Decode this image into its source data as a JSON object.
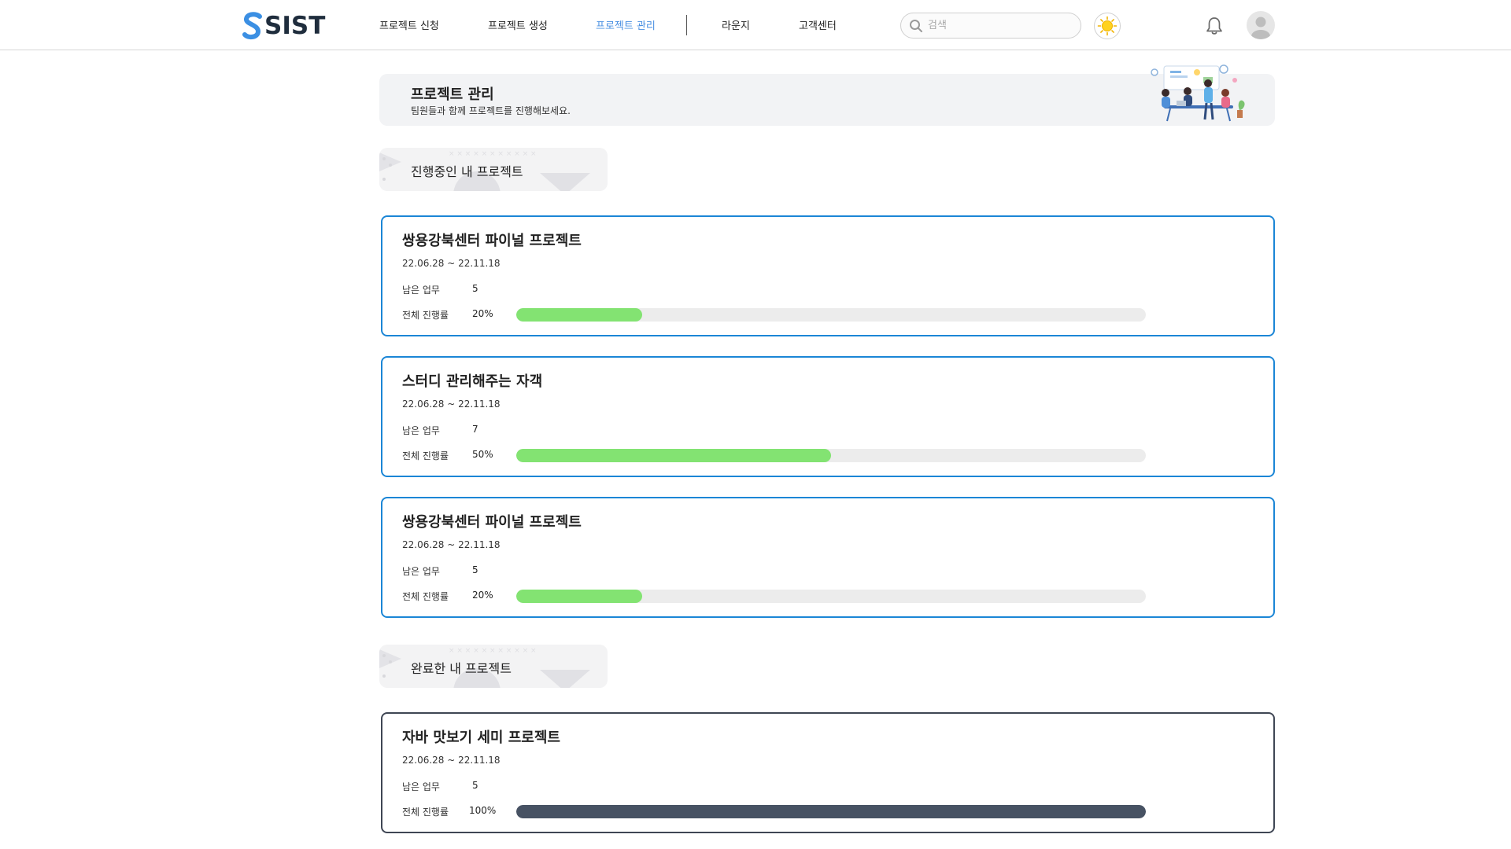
{
  "header": {
    "logo_text": "SIST",
    "nav": [
      {
        "label": "프로젝트 신청",
        "active": false
      },
      {
        "label": "프로젝트 생성",
        "active": false
      },
      {
        "label": "프로젝트 관리",
        "active": true
      },
      {
        "label": "라운지",
        "active": false
      },
      {
        "label": "고객센터",
        "active": false
      }
    ],
    "search_placeholder": "검색",
    "icons": {
      "search": "search-icon",
      "theme": "sun-icon",
      "notifications": "bell-icon",
      "profile": "avatar-icon"
    }
  },
  "banner": {
    "title": "프로젝트 관리",
    "subtitle": "팀원들과 함께 프로젝트를 진행해보세요."
  },
  "labels": {
    "remaining_tasks": "남은 업무",
    "overall_progress": "전체 진행률"
  },
  "sections": {
    "in_progress": {
      "title": "진행중인 내 프로젝트",
      "projects": [
        {
          "title": "쌍용강북센터 파이널 프로젝트",
          "period": "22.06.28 ~ 22.11.18",
          "remaining": "5",
          "progress_text": "20%",
          "progress": 20
        },
        {
          "title": "스터디 관리해주는 자객",
          "period": "22.06.28 ~ 22.11.18",
          "remaining": "7",
          "progress_text": "50%",
          "progress": 50
        },
        {
          "title": "쌍용강북센터 파이널 프로젝트",
          "period": "22.06.28 ~ 22.11.18",
          "remaining": "5",
          "progress_text": "20%",
          "progress": 20
        }
      ]
    },
    "completed": {
      "title": "완료한 내 프로젝트",
      "projects": [
        {
          "title": "자바 맛보기 세미 프로젝트",
          "period": "22.06.28 ~ 22.11.18",
          "remaining": "5",
          "progress_text": "100%",
          "progress": 100
        }
      ]
    }
  },
  "colors": {
    "accent_blue": "#1b86d6",
    "nav_active": "#4a90e2",
    "progress_green": "#83e372",
    "progress_done": "#475263",
    "card_done_border": "#3f4654"
  }
}
